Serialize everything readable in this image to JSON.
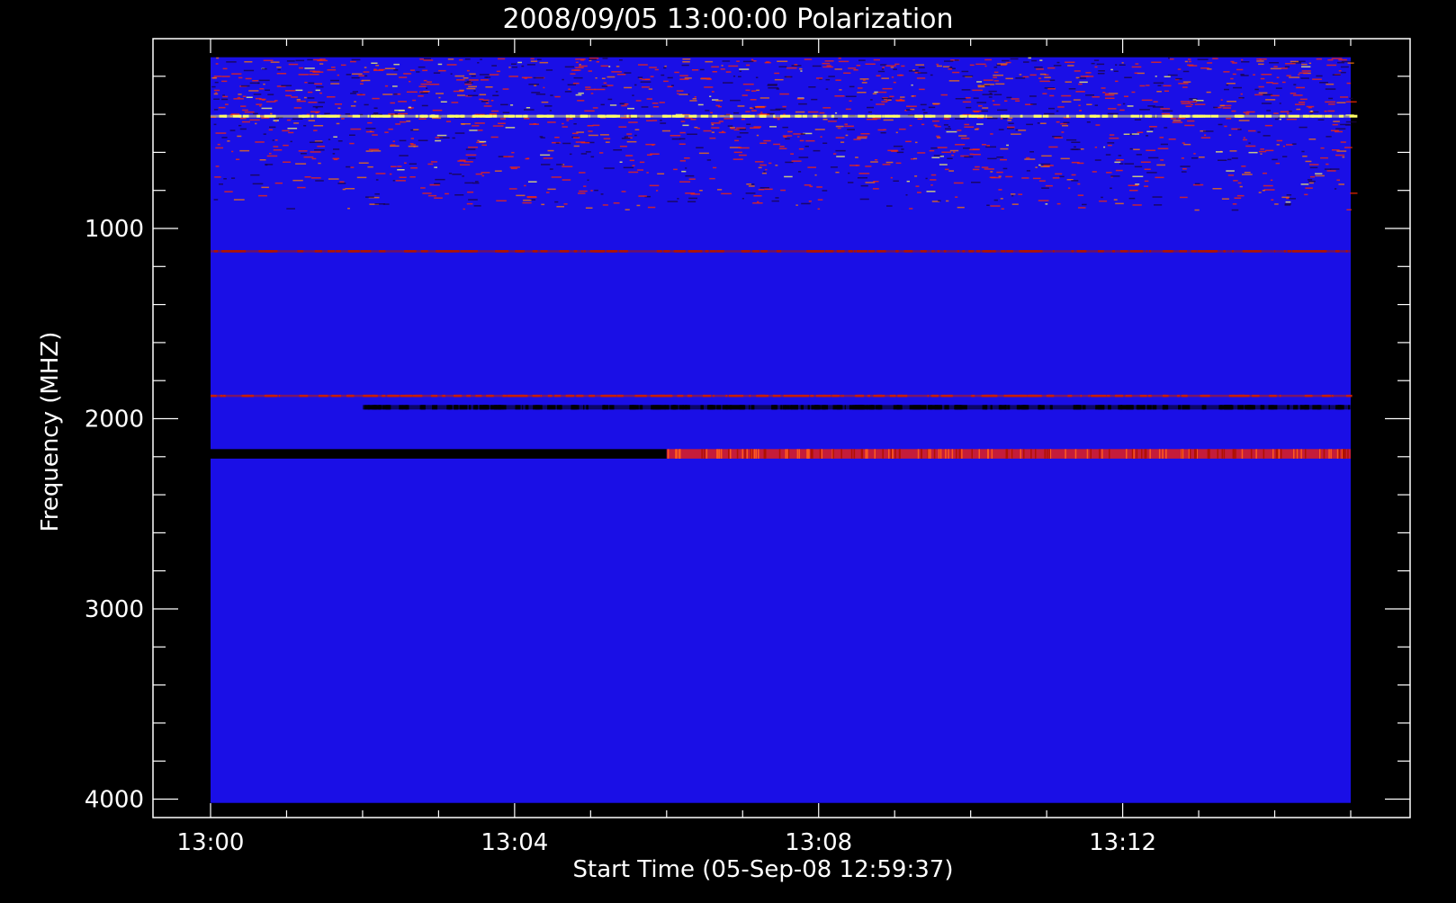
{
  "chart_data": {
    "type": "heatmap",
    "title": "2008/09/05 13:00:00 Polarization",
    "xlabel": "Start Time (05-Sep-08 12:59:37)",
    "ylabel": "Frequency (MHZ)",
    "x_tick_labels": [
      "13:00",
      "13:04",
      "13:08",
      "13:12"
    ],
    "x_range": [
      "13:00",
      "13:15"
    ],
    "y_tick_labels": [
      "1000",
      "2000",
      "3000",
      "4000"
    ],
    "y_ticks": [
      1000,
      2000,
      3000,
      4000
    ],
    "y_range": [
      0,
      4000
    ],
    "y_inverted": true,
    "data_extent": {
      "freq_mhz": [
        100,
        4020
      ],
      "time": [
        "13:00",
        "13:15"
      ]
    },
    "background_color": "#1a0fe6",
    "features": [
      {
        "kind": "noise-band",
        "freq_mhz": [
          100,
          900
        ],
        "time": [
          "13:00",
          "13:15"
        ],
        "color": "#ff2a00"
      },
      {
        "kind": "bright-line",
        "freq_mhz": 410,
        "time": [
          "13:00",
          "13:15"
        ],
        "color": "#ffff66"
      },
      {
        "kind": "interference-line",
        "freq_mhz": 1120,
        "time": [
          "13:00",
          "13:15"
        ],
        "color": "#b01400"
      },
      {
        "kind": "red-line",
        "freq_mhz": 1880,
        "time": [
          "13:00",
          "13:15"
        ],
        "color": "#c81e00"
      },
      {
        "kind": "dark-line",
        "freq_mhz": 1940,
        "time": [
          "13:02",
          "13:15"
        ],
        "color": "#000000"
      },
      {
        "kind": "dark-band",
        "freq_mhz": [
          2160,
          2210
        ],
        "time": [
          "13:00",
          "13:06"
        ],
        "color": "#000000"
      },
      {
        "kind": "bright-band",
        "freq_mhz": [
          2160,
          2210
        ],
        "time": [
          "13:06",
          "13:15"
        ],
        "color": "#ff2200"
      }
    ]
  }
}
